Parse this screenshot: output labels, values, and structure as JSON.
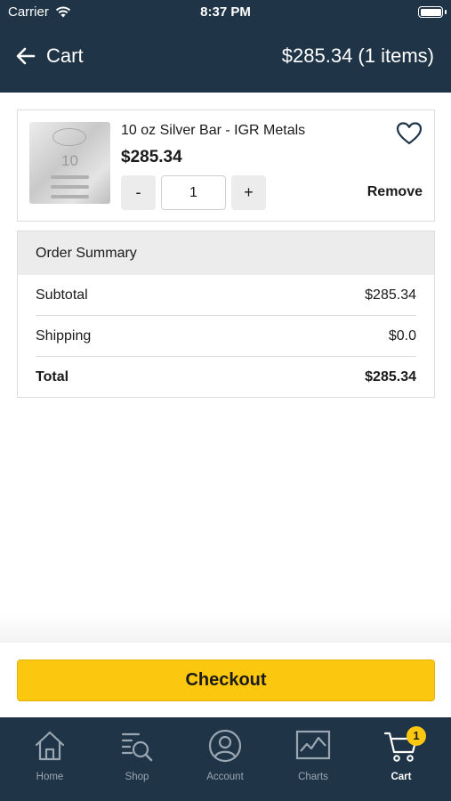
{
  "status_bar": {
    "carrier": "Carrier",
    "time": "8:37 PM"
  },
  "header": {
    "title": "Cart",
    "total": "$285.34 (1 items)"
  },
  "cart_item": {
    "name": "10 oz Silver Bar - IGR Metals",
    "price": "$285.34",
    "quantity": "1",
    "minus_label": "-",
    "plus_label": "+",
    "remove_label": "Remove",
    "thumbnail_number": "10"
  },
  "summary": {
    "heading": "Order Summary",
    "subtotal_label": "Subtotal",
    "subtotal_value": "$285.34",
    "shipping_label": "Shipping",
    "shipping_value": "$0.0",
    "total_label": "Total",
    "total_value": "$285.34"
  },
  "checkout_label": "Checkout",
  "tabs": [
    {
      "label": "Home",
      "icon": "home-icon"
    },
    {
      "label": "Shop",
      "icon": "shop-search-icon"
    },
    {
      "label": "Account",
      "icon": "account-icon"
    },
    {
      "label": "Charts",
      "icon": "chart-icon"
    },
    {
      "label": "Cart",
      "icon": "cart-icon",
      "badge": "1",
      "active": true
    }
  ],
  "colors": {
    "header_bg": "#1f3547",
    "accent": "#fcc70f",
    "inactive_tab": "#9aa6b1"
  }
}
